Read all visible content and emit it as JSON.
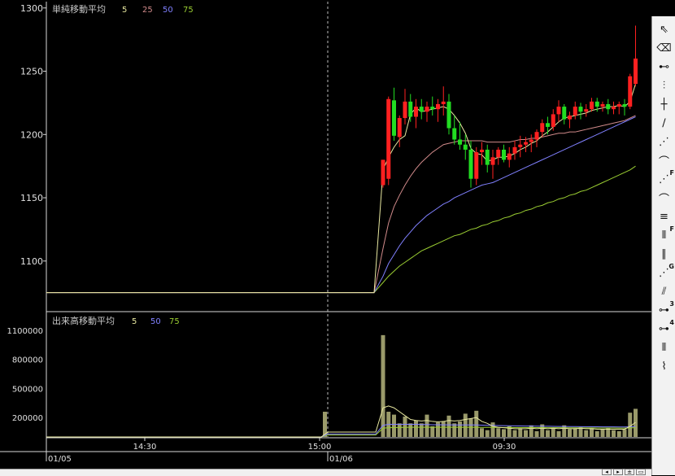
{
  "chart_data": {
    "type": "candlestick",
    "price_panel": {
      "legend_title": "単純移動平均",
      "ma_periods": [
        "5",
        "25",
        "50",
        "75"
      ],
      "ylim": [
        1060,
        1305
      ],
      "y_ticks": [
        1100,
        1150,
        1200,
        1250,
        1300
      ],
      "flat_level": 1075
    },
    "volume_panel": {
      "legend_title": "出来高移動平均",
      "ma_periods": [
        "5",
        "50",
        "75"
      ],
      "ylim": [
        0,
        1200000
      ],
      "y_ticks": [
        200000,
        500000,
        800000,
        1100000
      ],
      "y_tick_labels": [
        "200000",
        "500000",
        "800000",
        "1100000"
      ]
    },
    "x_time_labels": [
      "14:30",
      "15:00",
      "09:30"
    ],
    "x_date_labels": [
      "01/05",
      "01/06"
    ],
    "colors": {
      "up": "#ff2020",
      "down": "#22dd22",
      "ma5": "#e8e8a0",
      "ma25": "#d08a8a",
      "ma50": "#8080ff",
      "ma75": "#9acd32",
      "volume": "#9a9a6a",
      "axis": "#d8d8d8",
      "text": "#e0e0e0",
      "legend_text": "#c8c8c8"
    },
    "candles": [
      [
        1160,
        1180,
        1158,
        1180
      ],
      [
        1165,
        1230,
        1160,
        1228
      ],
      [
        1227,
        1237,
        1195,
        1199
      ],
      [
        1198,
        1215,
        1190,
        1213
      ],
      [
        1213,
        1236,
        1208,
        1226
      ],
      [
        1226,
        1232,
        1210,
        1214
      ],
      [
        1214,
        1228,
        1205,
        1222
      ],
      [
        1222,
        1228,
        1212,
        1218
      ],
      [
        1218,
        1226,
        1210,
        1222
      ],
      [
        1222,
        1230,
        1215,
        1220
      ],
      [
        1220,
        1228,
        1210,
        1224
      ],
      [
        1224,
        1238,
        1215,
        1226
      ],
      [
        1226,
        1232,
        1200,
        1205
      ],
      [
        1205,
        1215,
        1192,
        1196
      ],
      [
        1196,
        1210,
        1188,
        1192
      ],
      [
        1192,
        1200,
        1180,
        1188
      ],
      [
        1188,
        1195,
        1158,
        1165
      ],
      [
        1165,
        1190,
        1160,
        1186
      ],
      [
        1186,
        1194,
        1176,
        1188
      ],
      [
        1188,
        1192,
        1170,
        1176
      ],
      [
        1176,
        1188,
        1165,
        1182
      ],
      [
        1182,
        1190,
        1176,
        1188
      ],
      [
        1188,
        1192,
        1178,
        1180
      ],
      [
        1180,
        1190,
        1174,
        1185
      ],
      [
        1185,
        1195,
        1180,
        1190
      ],
      [
        1190,
        1199,
        1182,
        1192
      ],
      [
        1192,
        1198,
        1186,
        1194
      ],
      [
        1194,
        1200,
        1186,
        1196
      ],
      [
        1196,
        1204,
        1190,
        1202
      ],
      [
        1202,
        1212,
        1198,
        1209
      ],
      [
        1209,
        1214,
        1200,
        1206
      ],
      [
        1206,
        1220,
        1203,
        1216
      ],
      [
        1216,
        1227,
        1210,
        1222
      ],
      [
        1222,
        1224,
        1208,
        1212
      ],
      [
        1212,
        1218,
        1205,
        1215
      ],
      [
        1215,
        1226,
        1212,
        1222
      ],
      [
        1222,
        1225,
        1212,
        1218
      ],
      [
        1218,
        1224,
        1214,
        1220
      ],
      [
        1220,
        1229,
        1218,
        1226
      ],
      [
        1226,
        1229,
        1218,
        1222
      ],
      [
        1222,
        1226,
        1218,
        1224
      ],
      [
        1224,
        1228,
        1216,
        1220
      ],
      [
        1220,
        1226,
        1216,
        1222
      ],
      [
        1222,
        1226,
        1216,
        1224
      ],
      [
        1224,
        1228,
        1215,
        1222
      ],
      [
        1222,
        1248,
        1220,
        1246
      ],
      [
        1240,
        1286,
        1238,
        1260
      ]
    ],
    "ma5": [
      1172,
      1182,
      1190,
      1196,
      1199,
      1216,
      1221,
      1218,
      1219,
      1220,
      1221,
      1222,
      1220,
      1215,
      1209,
      1201,
      1189,
      1185,
      1184,
      1179,
      1180,
      1182,
      1182,
      1183,
      1185,
      1188,
      1190,
      1193,
      1195,
      1199,
      1202,
      1206,
      1210,
      1213,
      1214,
      1215,
      1216,
      1217,
      1219,
      1220,
      1221,
      1222,
      1222,
      1223,
      1222,
      1226,
      1240
    ],
    "ma25": [
      1110,
      1130,
      1143,
      1152,
      1160,
      1167,
      1173,
      1178,
      1182,
      1186,
      1189,
      1192,
      1193,
      1194,
      1195,
      1195,
      1195,
      1195,
      1195,
      1194,
      1194,
      1194,
      1194,
      1194,
      1195,
      1196,
      1196,
      1197,
      1197,
      1198,
      1199,
      1200,
      1201,
      1201,
      1202,
      1202,
      1203,
      1204,
      1205,
      1206,
      1207,
      1208,
      1209,
      1210,
      1211,
      1213,
      1215
    ],
    "ma50": [
      1088,
      1098,
      1105,
      1112,
      1118,
      1123,
      1128,
      1132,
      1136,
      1139,
      1142,
      1145,
      1147,
      1150,
      1152,
      1154,
      1156,
      1158,
      1160,
      1161,
      1162,
      1164,
      1166,
      1168,
      1170,
      1172,
      1174,
      1176,
      1178,
      1180,
      1182,
      1184,
      1186,
      1188,
      1190,
      1192,
      1194,
      1196,
      1198,
      1200,
      1202,
      1204,
      1206,
      1208,
      1210,
      1212,
      1214
    ],
    "ma75": [
      1083,
      1088,
      1092,
      1096,
      1099,
      1102,
      1105,
      1108,
      1110,
      1112,
      1114,
      1116,
      1118,
      1120,
      1121,
      1123,
      1125,
      1126,
      1128,
      1129,
      1131,
      1132,
      1134,
      1135,
      1137,
      1138,
      1140,
      1141,
      1143,
      1144,
      1146,
      1147,
      1149,
      1150,
      1152,
      1153,
      1155,
      1156,
      1158,
      1160,
      1162,
      1164,
      1166,
      1168,
      1170,
      1172,
      1175
    ],
    "pre_session_volume": 260000,
    "volumes": [
      1050000,
      260000,
      230000,
      140000,
      210000,
      140000,
      170000,
      140000,
      230000,
      110000,
      150000,
      160000,
      220000,
      140000,
      160000,
      240000,
      190000,
      270000,
      90000,
      70000,
      150000,
      90000,
      80000,
      110000,
      70000,
      90000,
      70000,
      120000,
      60000,
      130000,
      70000,
      90000,
      60000,
      120000,
      80000,
      90000,
      100000,
      70000,
      90000,
      60000,
      80000,
      90000,
      70000,
      60000,
      80000,
      250000,
      290000
    ],
    "vol_ma5": [
      300000,
      320000,
      300000,
      260000,
      220000,
      180000,
      170000,
      165000,
      170000,
      160000,
      155000,
      160000,
      170000,
      165000,
      170000,
      180000,
      190000,
      200000,
      160000,
      140000,
      110000,
      100000,
      95000,
      90000,
      85000,
      85000,
      85000,
      90000,
      85000,
      90000,
      85000,
      90000,
      85000,
      90000,
      85000,
      85000,
      90000,
      85000,
      85000,
      80000,
      80000,
      80000,
      80000,
      80000,
      80000,
      110000,
      150000
    ],
    "vol_ma50": [
      120000,
      130000,
      130000,
      130000,
      130000,
      130000,
      130000,
      128000,
      128000,
      126000,
      126000,
      125000,
      125000,
      124000,
      124000,
      124000,
      124000,
      124000,
      122000,
      120000,
      120000,
      118000,
      116000,
      115000,
      114000,
      113000,
      112000,
      112000,
      111000,
      110000,
      110000,
      109000,
      108000,
      108000,
      107000,
      107000,
      106000,
      106000,
      105000,
      105000,
      104000,
      104000,
      104000,
      103000,
      103000,
      105000,
      108000
    ],
    "vol_ma75": [
      90000,
      95000,
      97000,
      98000,
      99000,
      100000,
      100000,
      100000,
      100000,
      100000,
      100000,
      100000,
      100000,
      100000,
      100000,
      100000,
      100000,
      100000,
      99000,
      99000,
      99000,
      98000,
      98000,
      98000,
      97000,
      97000,
      97000,
      96000,
      96000,
      96000,
      95000,
      95000,
      95000,
      94000,
      94000,
      94000,
      93000,
      93000,
      93000,
      92000,
      92000,
      92000,
      92000,
      91000,
      91000,
      93000,
      95000
    ]
  },
  "toolbar": {
    "tools": [
      {
        "name": "cursor-icon",
        "glyph": "⇖",
        "sub": ""
      },
      {
        "name": "eraser-icon",
        "glyph": "⌫",
        "sub": ""
      },
      {
        "name": "horizontal-line-icon",
        "glyph": "⊷",
        "sub": ""
      },
      {
        "name": "vertical-line-icon",
        "glyph": "⫶",
        "sub": ""
      },
      {
        "name": "cross-line-icon",
        "glyph": "┼",
        "sub": ""
      },
      {
        "name": "trend-line-icon",
        "glyph": "∕",
        "sub": ""
      },
      {
        "name": "fan-line-icon",
        "glyph": "⋰",
        "sub": ""
      },
      {
        "name": "arc-icon",
        "glyph": "⌒",
        "sub": ""
      },
      {
        "name": "fibonacci-fan-icon",
        "glyph": "⋰",
        "sub": "F"
      },
      {
        "name": "fibonacci-arc-icon",
        "glyph": "⌒",
        "sub": ""
      },
      {
        "name": "fibonacci-retracement-icon",
        "glyph": "≡",
        "sub": ""
      },
      {
        "name": "fibonacci-time-icon",
        "glyph": "⦀",
        "sub": "F"
      },
      {
        "name": "parallel-line-icon",
        "glyph": "∥",
        "sub": ""
      },
      {
        "name": "gann-fan-icon",
        "glyph": "⋰",
        "sub": "G"
      },
      {
        "name": "speed-line-icon",
        "glyph": "⫽",
        "sub": ""
      },
      {
        "name": "three-line-icon",
        "glyph": "⊶",
        "sub": "3"
      },
      {
        "name": "four-line-icon",
        "glyph": "⊶",
        "sub": "4"
      },
      {
        "name": "cycle-line-icon",
        "glyph": "⦀",
        "sub": ""
      },
      {
        "name": "wave-icon",
        "glyph": "⌇",
        "sub": ""
      }
    ]
  },
  "bottom_buttons": [
    {
      "name": "scroll-left-button",
      "glyph": "◂"
    },
    {
      "name": "scroll-right-button",
      "glyph": "▸"
    },
    {
      "name": "zoom-button",
      "glyph": "±"
    },
    {
      "name": "window-button",
      "glyph": "▭"
    }
  ]
}
